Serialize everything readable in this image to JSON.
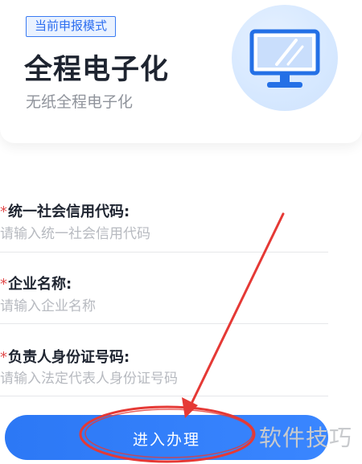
{
  "header": {
    "mode_badge": "当前申报模式",
    "title": "全程电子化",
    "subtitle": "无纸全程电子化",
    "icon": "monitor-icon"
  },
  "form": {
    "fields": [
      {
        "label": "统一社会信用代码:",
        "placeholder": "请输入统一社会信用代码",
        "required": true
      },
      {
        "label": "企业名称:",
        "placeholder": "请输入企业名称",
        "required": true
      },
      {
        "label": "负责人身份证号码:",
        "placeholder": "请输入法定代表人身份证号码",
        "required": true
      }
    ],
    "required_mark": "*"
  },
  "submit": {
    "label": "进入办理"
  },
  "watermark": "软件技巧",
  "colors": {
    "accent": "#2d6ef0",
    "required": "#e14b4b",
    "annotation": "#e53935"
  }
}
